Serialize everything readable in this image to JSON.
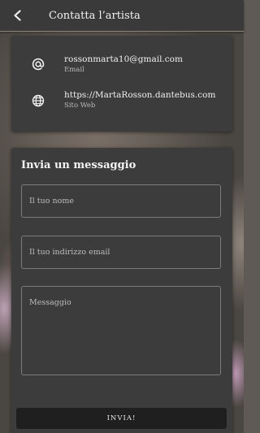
{
  "header": {
    "back_icon": "chevron-left-icon",
    "title": "Contatta l’artista"
  },
  "contacts": [
    {
      "icon": "at-sign-icon",
      "value": "rossonmarta10@gmail.com",
      "label": "Email"
    },
    {
      "icon": "globe-icon",
      "value": "https://MartaRosson.dantebus.com",
      "label": "Sito Web"
    }
  ],
  "form": {
    "title": "Invia un messaggio",
    "name_placeholder": "Il tuo nome",
    "email_placeholder": "Il tuo indirizzo email",
    "message_placeholder": "Messaggio",
    "submit_label": "INVIA!"
  }
}
